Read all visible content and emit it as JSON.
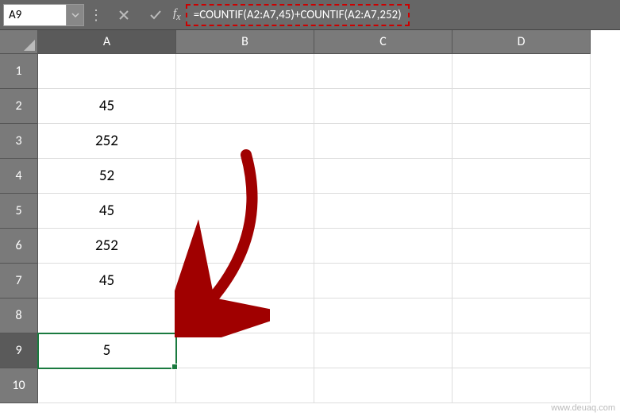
{
  "nameBox": "A9",
  "formula": "=COUNTIF(A2:A7,45)+COUNTIF(A2:A7,252)",
  "columns": [
    "A",
    "B",
    "C",
    "D"
  ],
  "rows": [
    "1",
    "2",
    "3",
    "4",
    "5",
    "6",
    "7",
    "8",
    "9",
    "10"
  ],
  "cells": {
    "A2": "45",
    "A3": "252",
    "A4": "52",
    "A5": "45",
    "A6": "252",
    "A7": "45",
    "A9": "5"
  },
  "selectedCell": "A9",
  "watermark": "www.deuaq.com"
}
